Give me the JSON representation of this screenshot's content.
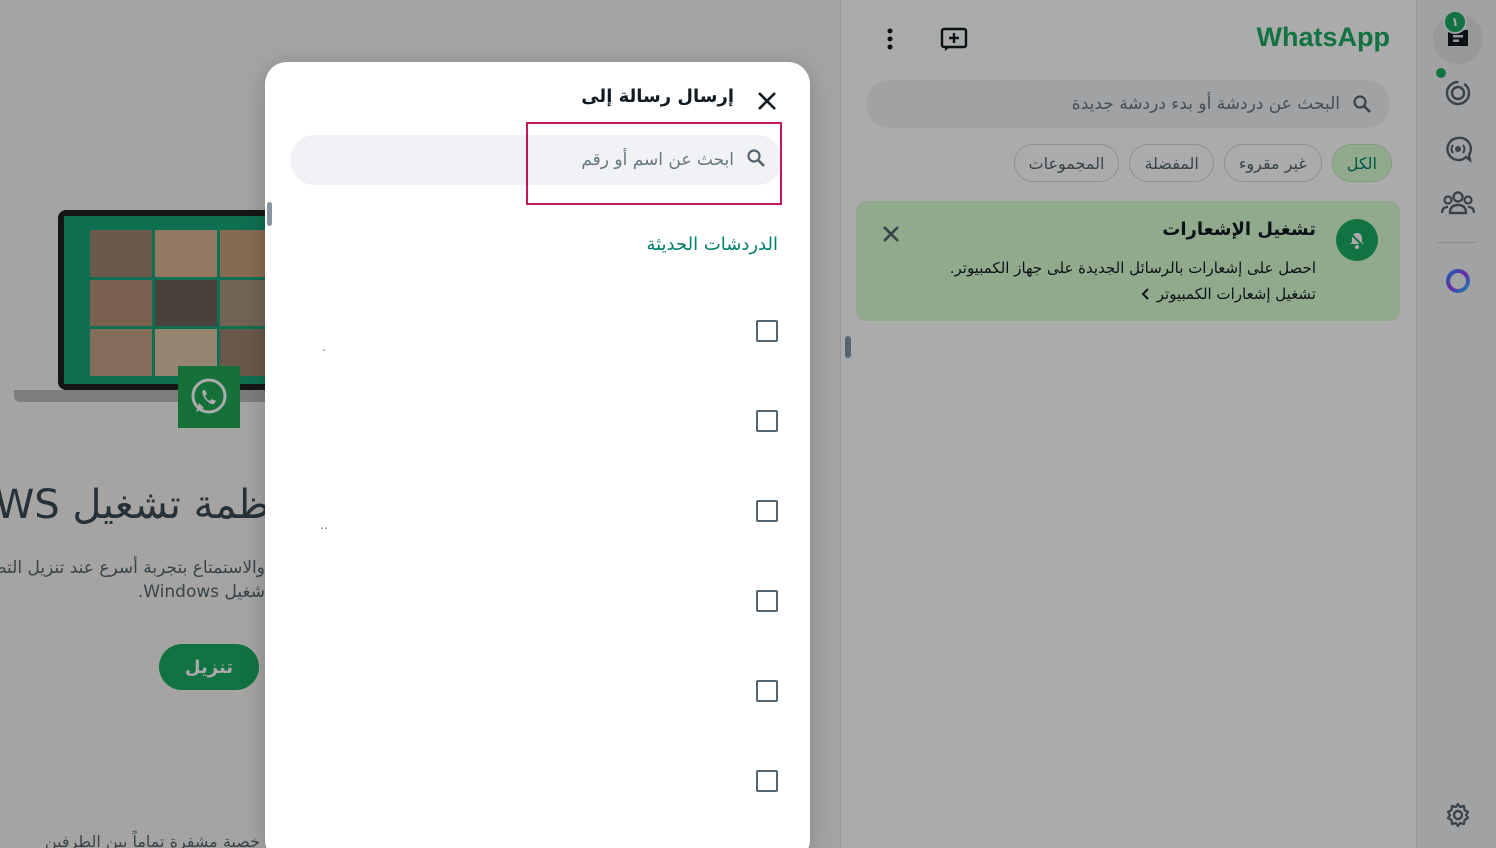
{
  "app": {
    "brand": "WhatsApp"
  },
  "nav": {
    "chats_badge": "١",
    "items": [
      {
        "icon": "chats-icon",
        "label": ""
      },
      {
        "icon": "status-icon",
        "label": ""
      },
      {
        "icon": "channels-icon",
        "label": ""
      },
      {
        "icon": "communities-icon",
        "label": ""
      },
      {
        "icon": "meta-ai-icon",
        "label": ""
      },
      {
        "icon": "settings-icon",
        "label": ""
      }
    ]
  },
  "chat_list": {
    "search_placeholder": "البحث عن دردشة أو بدء دردشة جديدة",
    "filters": [
      "الكل",
      "غير مقروء",
      "المفضلة",
      "المجموعات"
    ],
    "active_filter": "الكل",
    "notification": {
      "title": "تشغيل الإشعارات",
      "body": "احصل على إشعارات بالرسائل الجديدة على جهاز الكمبيوتر.",
      "link": "تشغيل إشعارات الكمبيوتر"
    }
  },
  "promo": {
    "heading": "ظمة تشغيل WS",
    "line1": "والاستمتاع بتجربة أسرع عند تنزيل التط",
    "line2": "شغيل Windows.",
    "download_label": "تنزيل",
    "footer": "خصية مشفرة تماماً بين الطرفين"
  },
  "modal": {
    "title": "إرسال رسالة إلى",
    "search_placeholder": "ابحث عن اسم أو رقم",
    "section_label": "الدردشات الحديثة",
    "rows": [
      {
        "checked": false,
        "mark": "."
      },
      {
        "checked": false,
        "mark": ""
      },
      {
        "checked": false,
        "mark": ".."
      },
      {
        "checked": false,
        "mark": ""
      },
      {
        "checked": false,
        "mark": ""
      },
      {
        "checked": false,
        "mark": ""
      }
    ]
  },
  "colors": {
    "accent": "#1daa61",
    "accent_dark": "#008069",
    "focus_outline": "#c2185b",
    "notification_bg": "#d9fdd3"
  }
}
